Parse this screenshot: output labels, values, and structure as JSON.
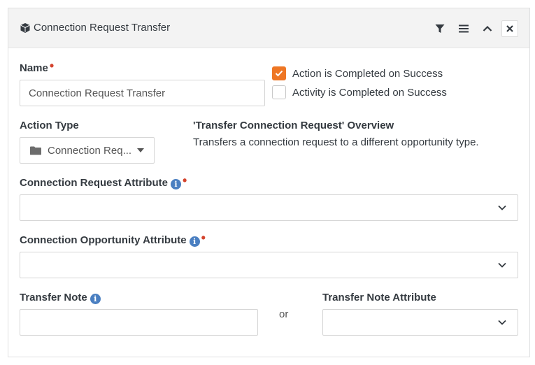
{
  "panel": {
    "title": "Connection Request Transfer",
    "icon": "cube-icon"
  },
  "header_actions": [
    "filter-icon",
    "menu-icon",
    "chevron-up-icon",
    "close-icon"
  ],
  "name_field": {
    "label": "Name",
    "value": "Connection Request Transfer"
  },
  "checkboxes": {
    "action_completed": {
      "label": "Action is Completed on Success",
      "checked": true
    },
    "activity_completed": {
      "label": "Activity is Completed on Success",
      "checked": false
    }
  },
  "action_type": {
    "label": "Action Type",
    "value": "Connection Req..."
  },
  "overview": {
    "title": "'Transfer Connection Request' Overview",
    "text": "Transfers a connection request to a different opportunity type."
  },
  "connection_request_attribute": {
    "label": "Connection Request Attribute",
    "value": ""
  },
  "connection_opportunity_attribute": {
    "label": "Connection Opportunity Attribute",
    "value": ""
  },
  "transfer_note": {
    "label": "Transfer Note",
    "value": ""
  },
  "or_text": "or",
  "transfer_note_attribute": {
    "label": "Transfer Note Attribute",
    "value": ""
  },
  "colors": {
    "accent": "#ee7624",
    "required": "#d4442e",
    "info": "#4a7fc1"
  }
}
